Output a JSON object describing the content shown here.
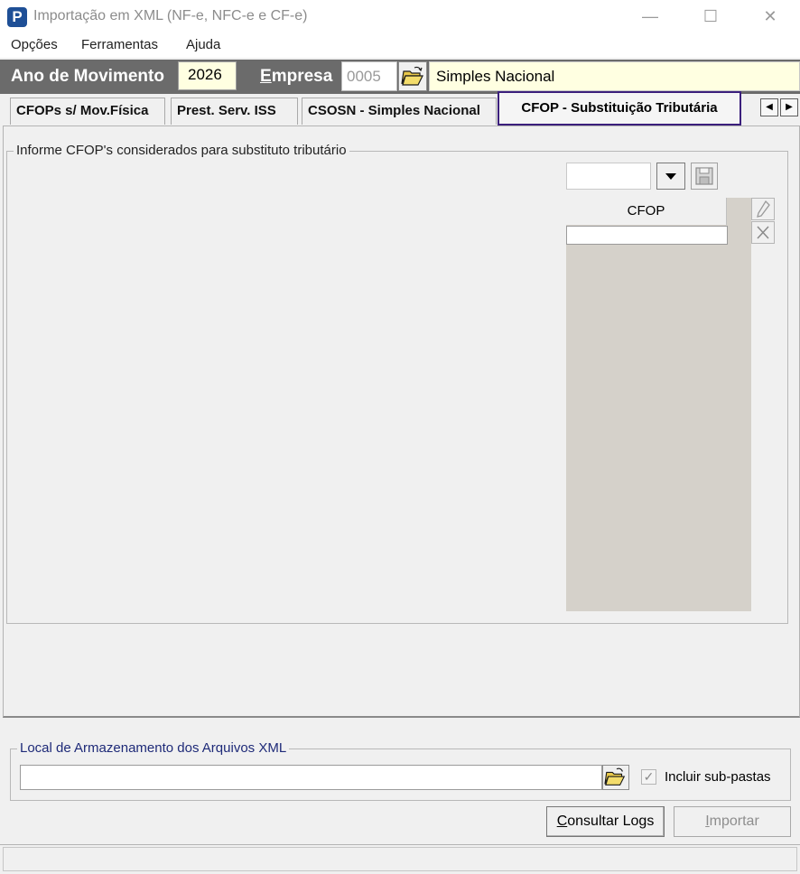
{
  "window": {
    "title": "Importação em XML (NF-e, NFC-e e CF-e)",
    "app_icon_letter": "P"
  },
  "menu": {
    "items": [
      "Opções",
      "Ferramentas",
      "Ajuda"
    ]
  },
  "header": {
    "year_label": "Ano de Movimento",
    "year_value": "2026",
    "company_label": "Empresa",
    "company_code": "0005",
    "company_name": "Simples Nacional"
  },
  "tabs": {
    "items": [
      {
        "label": "CFOPs s/ Mov.Física"
      },
      {
        "label": "Prest. Serv. ISS"
      },
      {
        "label": "CSOSN - Simples Nacional"
      },
      {
        "label": "CFOP - Substituição Tributária"
      }
    ],
    "active_index": 3
  },
  "cfop_panel": {
    "group_label": "Informe CFOP's considerados para substituto tributário",
    "select_value": "",
    "column_header": "CFOP"
  },
  "storage": {
    "group_label": "Local de Armazenamento dos Arquivos XML",
    "path_value": "",
    "subfolders_label": "Incluir sub-pastas",
    "subfolders_checked": true
  },
  "buttons": {
    "logs": "Consultar Logs",
    "import": "Importar"
  },
  "colors": {
    "header_bar": "#6b6b6b",
    "highlight_field": "#ffffe1",
    "active_tab_border": "#3b1f7c",
    "grid_background": "#d5d1ca"
  }
}
